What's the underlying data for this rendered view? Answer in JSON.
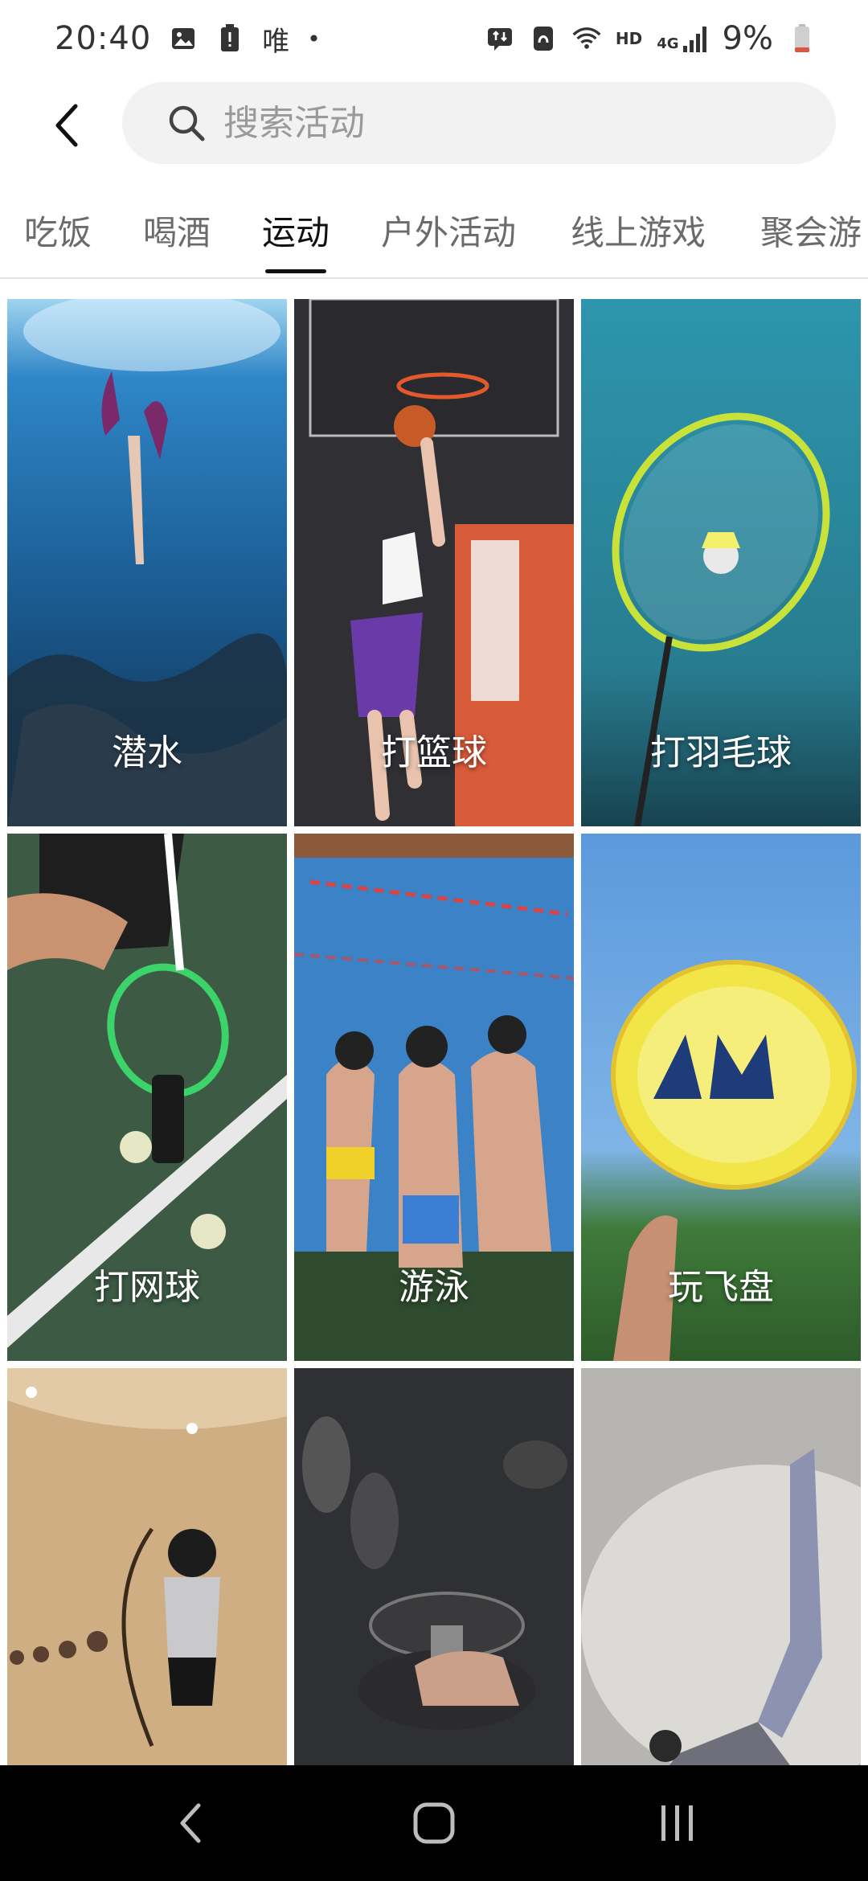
{
  "status_bar": {
    "time": "20:40",
    "carrier_glyph": "唯",
    "dot": "•",
    "network_hd": "HD",
    "network_type": "4G",
    "battery_text": "9%",
    "icons": [
      "image-icon",
      "alert-icon",
      "data-transfer-icon",
      "nfc-icon",
      "wifi-icon",
      "signal-icon",
      "battery-icon"
    ]
  },
  "header": {
    "back_icon": "chevron-left-icon",
    "search_icon": "search-icon",
    "search_placeholder": "搜索活动",
    "search_value": ""
  },
  "tabs": [
    {
      "label": "吃饭",
      "active": false
    },
    {
      "label": "喝酒",
      "active": false
    },
    {
      "label": "运动",
      "active": true
    },
    {
      "label": "户外活动",
      "active": false
    },
    {
      "label": "线上游戏",
      "active": false
    },
    {
      "label": "聚会游",
      "active": false
    }
  ],
  "activities": [
    {
      "label": "潜水",
      "icon": "diving-image",
      "color": "#1f5b8f"
    },
    {
      "label": "打篮球",
      "icon": "basketball-image",
      "color": "#3a3a40"
    },
    {
      "label": "打羽毛球",
      "icon": "badminton-image",
      "color": "#2e8ea0"
    },
    {
      "label": "打网球",
      "icon": "tennis-image",
      "color": "#3f5e45"
    },
    {
      "label": "游泳",
      "icon": "swimming-image",
      "color": "#3b7ec0"
    },
    {
      "label": "玩飞盘",
      "icon": "frisbee-image",
      "color": "#5b97d8"
    },
    {
      "label": "",
      "icon": "archery-image",
      "color": "#c9a57a"
    },
    {
      "label": "",
      "icon": "dumbbell-image",
      "color": "#3c3c40"
    },
    {
      "label": "",
      "icon": "yoga-image",
      "color": "#b9b6b2"
    }
  ],
  "nav_bar": {
    "back_icon": "nav-back-icon",
    "home_icon": "nav-home-icon",
    "recents_icon": "nav-recents-icon"
  }
}
